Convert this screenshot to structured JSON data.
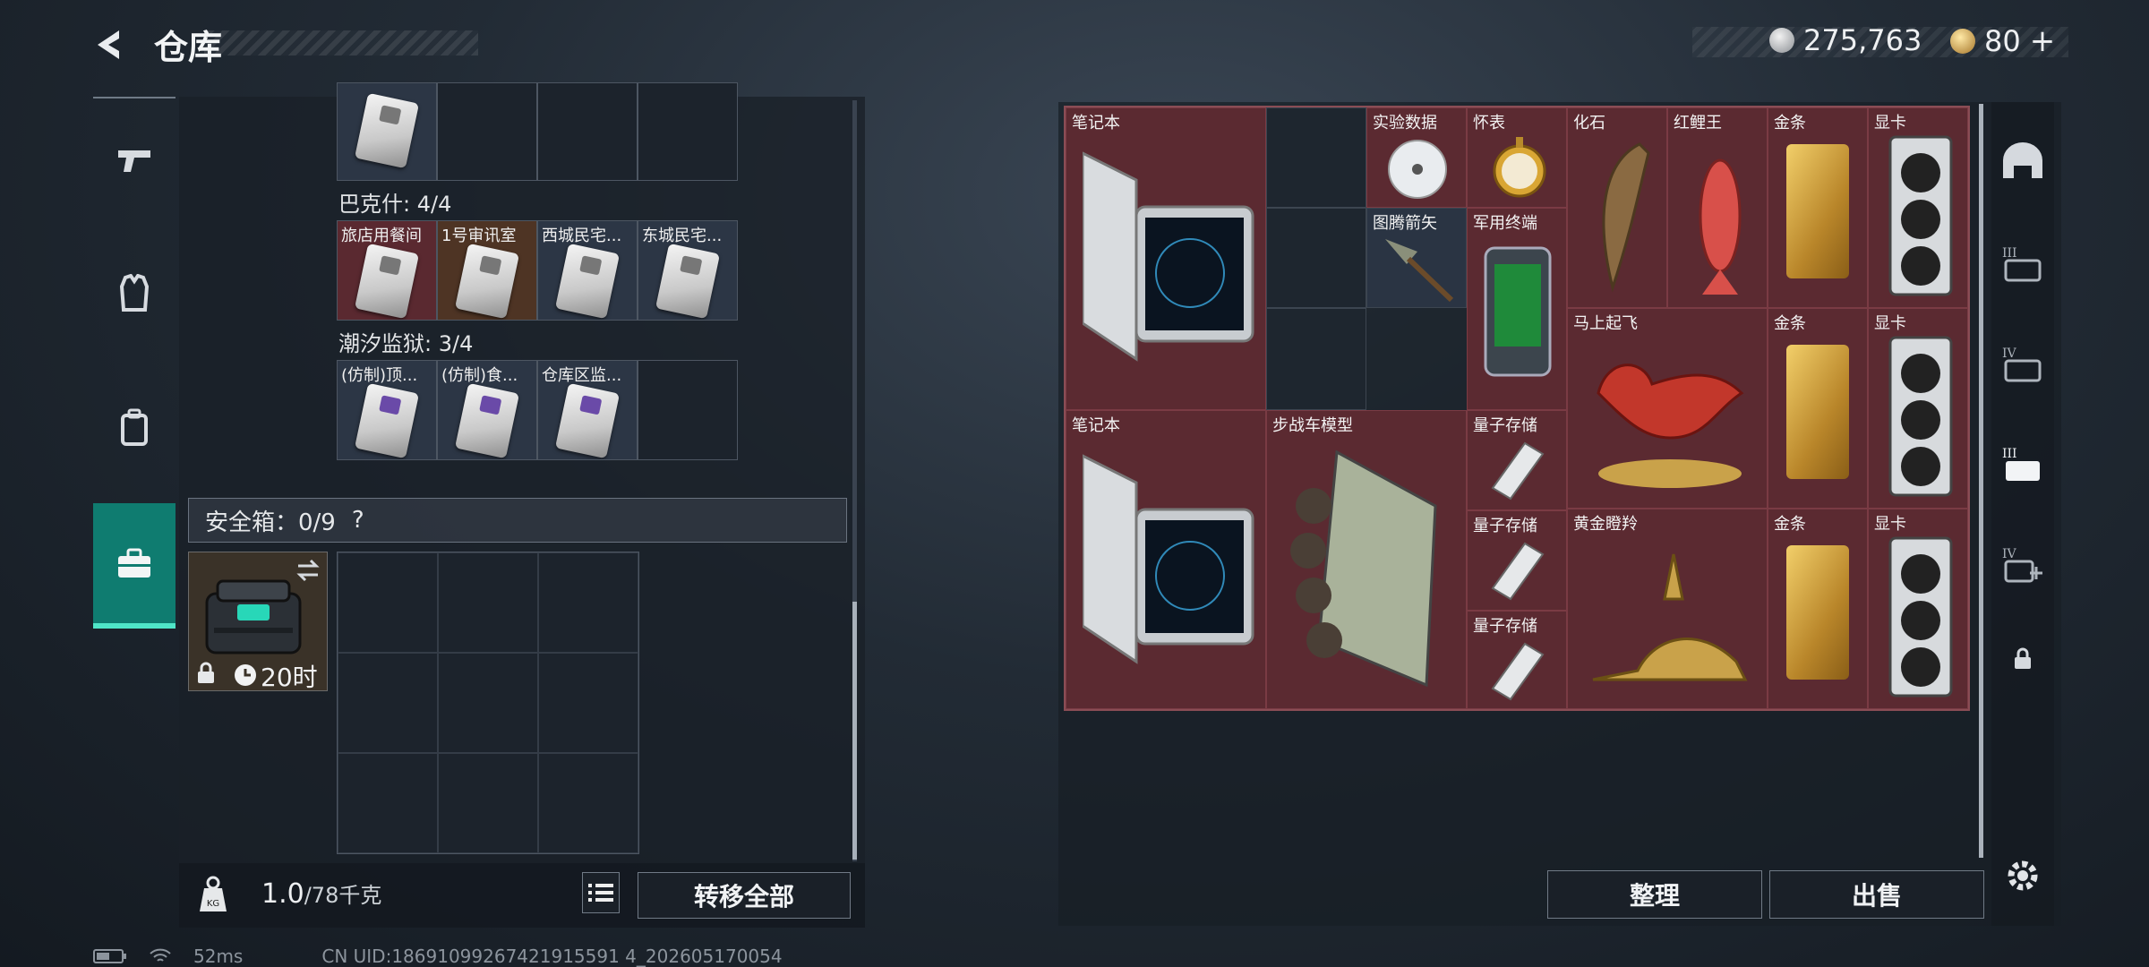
{
  "header": {
    "title": "仓库",
    "currency": {
      "silver": "275,763",
      "gold": "80",
      "gold_add": "+"
    }
  },
  "left_tabs": [
    {
      "name": "weapon-tab-icon"
    },
    {
      "name": "armor-tab-icon"
    },
    {
      "name": "backpack-tab-icon"
    },
    {
      "name": "safebox-tab-icon",
      "active": true
    }
  ],
  "stash": {
    "section_bakeshi": "巴克什: 4/4",
    "bakeshi_cards": [
      "旅店用餐间",
      "1号审讯室",
      "西城民宅...",
      "东城民宅..."
    ],
    "section_prison": "潮汐监狱: 3/4",
    "prison_cards": [
      "(仿制)顶...",
      "(仿制)食...",
      "仓库区监..."
    ],
    "safebox_label": "安全箱：0/9",
    "safebox_help": "?",
    "safebox_timer": "20时",
    "weight_value": "1.0",
    "weight_max": "/78千克",
    "transfer_all": "转移全部"
  },
  "inventory": {
    "items": {
      "notebook1": "笔记本",
      "expdata": "实验数据",
      "pocketwatch": "怀表",
      "fossil": "化石",
      "redcarp": "红鲤王",
      "gold1": "金条",
      "gpu1": "显卡",
      "totem_arrow": "图腾箭矢",
      "mil_terminal": "军用终端",
      "horse": "马上起飞",
      "gold2": "金条",
      "gpu2": "显卡",
      "notebook2": "笔记本",
      "ifv_model": "步战车模型",
      "quantum1": "量子存储",
      "quantum2": "量子存储",
      "golden_deer": "黄金瞪羚",
      "gold3": "金条",
      "gpu3": "显卡",
      "quantum3": "量子存储"
    },
    "sort_button": "整理",
    "sell_button": "出售"
  },
  "right_sidebar": [
    "helmet-slot-icon",
    "tier3-case-icon",
    "tier4-case-icon",
    "tier3-case-active-icon",
    "tier4-case-add-icon",
    "lock-icon",
    "settings-icon"
  ],
  "status": {
    "ping": "52ms",
    "uid": "CN UID:18691099267421915591 4_202605170054"
  },
  "colors": {
    "accent_teal": "#0f7c70",
    "item_red": "#5b2a31",
    "gold": "#c9a24a"
  }
}
